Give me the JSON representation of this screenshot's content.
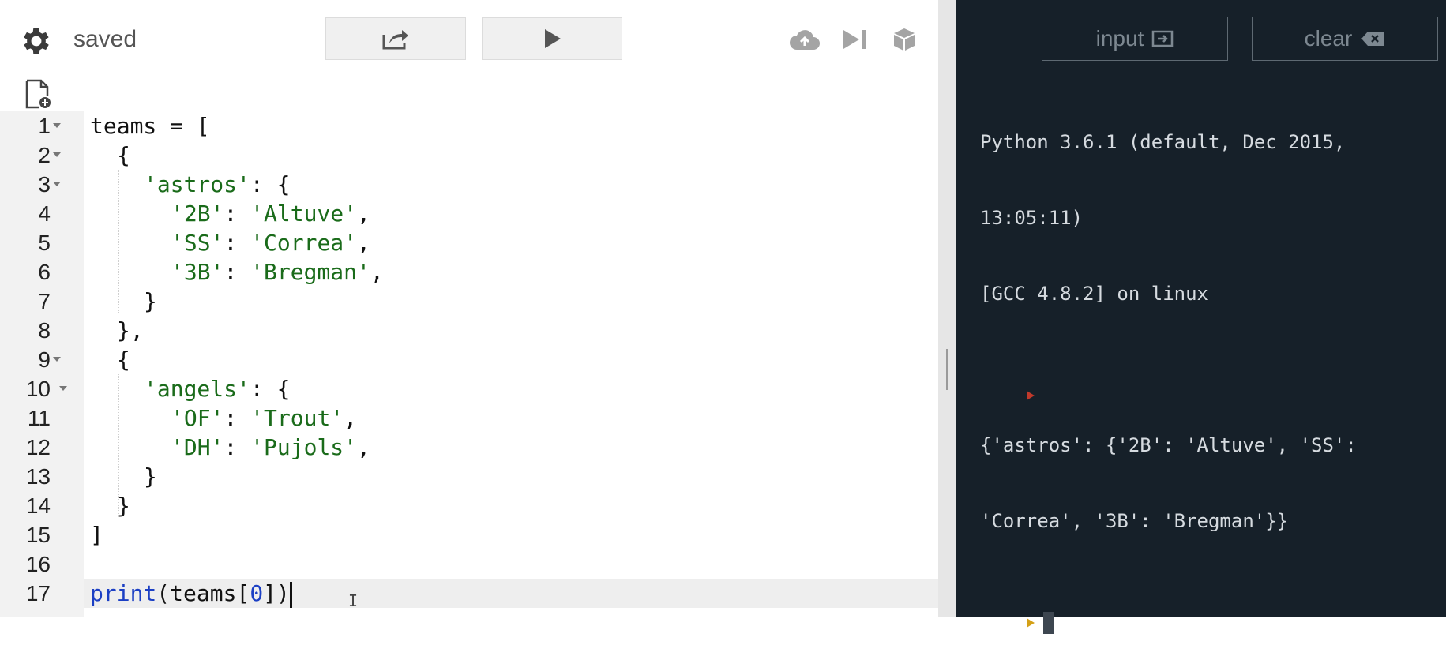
{
  "toolbar": {
    "status": "saved",
    "icons": [
      "gear-icon",
      "share-icon",
      "play-icon",
      "cloud-upload-icon",
      "step-forward-icon",
      "package-icon",
      "new-file-icon"
    ]
  },
  "editor": {
    "lines": [
      {
        "num": "1",
        "fold": true
      },
      {
        "num": "2",
        "fold": true
      },
      {
        "num": "3",
        "fold": true
      },
      {
        "num": "4",
        "fold": false
      },
      {
        "num": "5",
        "fold": false
      },
      {
        "num": "6",
        "fold": false
      },
      {
        "num": "7",
        "fold": false
      },
      {
        "num": "8",
        "fold": false
      },
      {
        "num": "9",
        "fold": true
      },
      {
        "num": "10",
        "fold": true
      },
      {
        "num": "11",
        "fold": false
      },
      {
        "num": "12",
        "fold": false
      },
      {
        "num": "13",
        "fold": false
      },
      {
        "num": "14",
        "fold": false
      },
      {
        "num": "15",
        "fold": false
      },
      {
        "num": "16",
        "fold": false
      },
      {
        "num": "17",
        "fold": false
      }
    ],
    "code": {
      "l1_a": "teams = [",
      "l2": "{",
      "l3_key": "'astros'",
      "l3_rest": ": {",
      "l4_key": "'2B'",
      "l4_val": "'Altuve'",
      "l5_key": "'SS'",
      "l5_val": "'Correa'",
      "l6_key": "'3B'",
      "l6_val": "'Bregman'",
      "l7": "}",
      "l8": "},",
      "l9": "{",
      "l10_key": "'angels'",
      "l10_rest": ": {",
      "l11_key": "'OF'",
      "l11_val": "'Trout'",
      "l12_key": "'DH'",
      "l12_val": "'Pujols'",
      "l13": "}",
      "l14": "}",
      "l15": "]",
      "l17_fn": "print",
      "l17_a": "(teams[",
      "l17_num": "0",
      "l17_b": "])",
      "colon": ": ",
      "comma": ","
    }
  },
  "console_panel": {
    "input_label": "input",
    "clear_label": "clear",
    "header_line1": "Python 3.6.1 (default, Dec 2015,",
    "header_line2": "13:05:11)",
    "header_line3": "[GCC 4.8.2] on linux",
    "output_line1": "{'astros': {'2B': 'Altuve', 'SS':",
    "output_line2": "'Correa', '3B': 'Bregman'}}",
    "prompt_color_prev": "#c0392b",
    "prompt_color_active": "#d4a017"
  }
}
